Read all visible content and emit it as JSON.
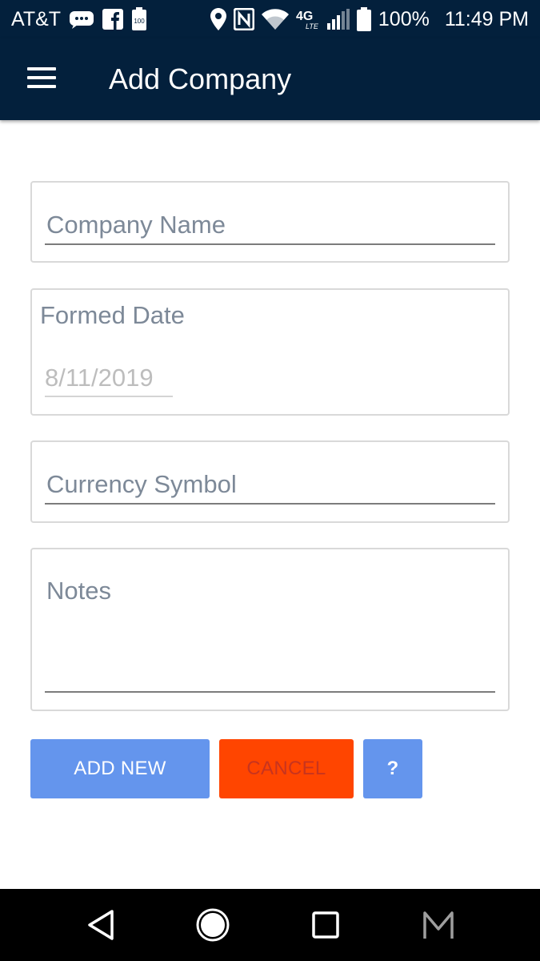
{
  "status_bar": {
    "carrier": "AT&T",
    "battery_small": "100",
    "network": "4G",
    "network_sub": "LTE",
    "battery_percent": "100%",
    "time": "11:49 PM",
    "icons": [
      "messages-icon",
      "facebook-icon",
      "battery-saver-icon",
      "location-icon",
      "nfc-icon",
      "wifi-icon",
      "lte-icon",
      "signal-icon",
      "battery-icon"
    ]
  },
  "app_bar": {
    "title": "Add Company",
    "menu_icon": "hamburger-menu-icon"
  },
  "form": {
    "company_name": {
      "placeholder": "Company Name",
      "value": ""
    },
    "formed_date": {
      "label": "Formed Date",
      "value": "8/11/2019"
    },
    "currency_symbol": {
      "placeholder": "Currency Symbol",
      "value": ""
    },
    "notes": {
      "placeholder": "Notes",
      "value": ""
    }
  },
  "buttons": {
    "add_new": "ADD NEW",
    "cancel": "CANCEL",
    "help": "?"
  },
  "colors": {
    "app_bar": "#03203c",
    "primary_button": "#6495ed",
    "cancel_button": "#ff4500",
    "cancel_text": "#c8341e"
  },
  "nav_bar": {
    "icons": [
      "back-icon",
      "home-icon",
      "recents-icon",
      "m-app-icon"
    ]
  }
}
